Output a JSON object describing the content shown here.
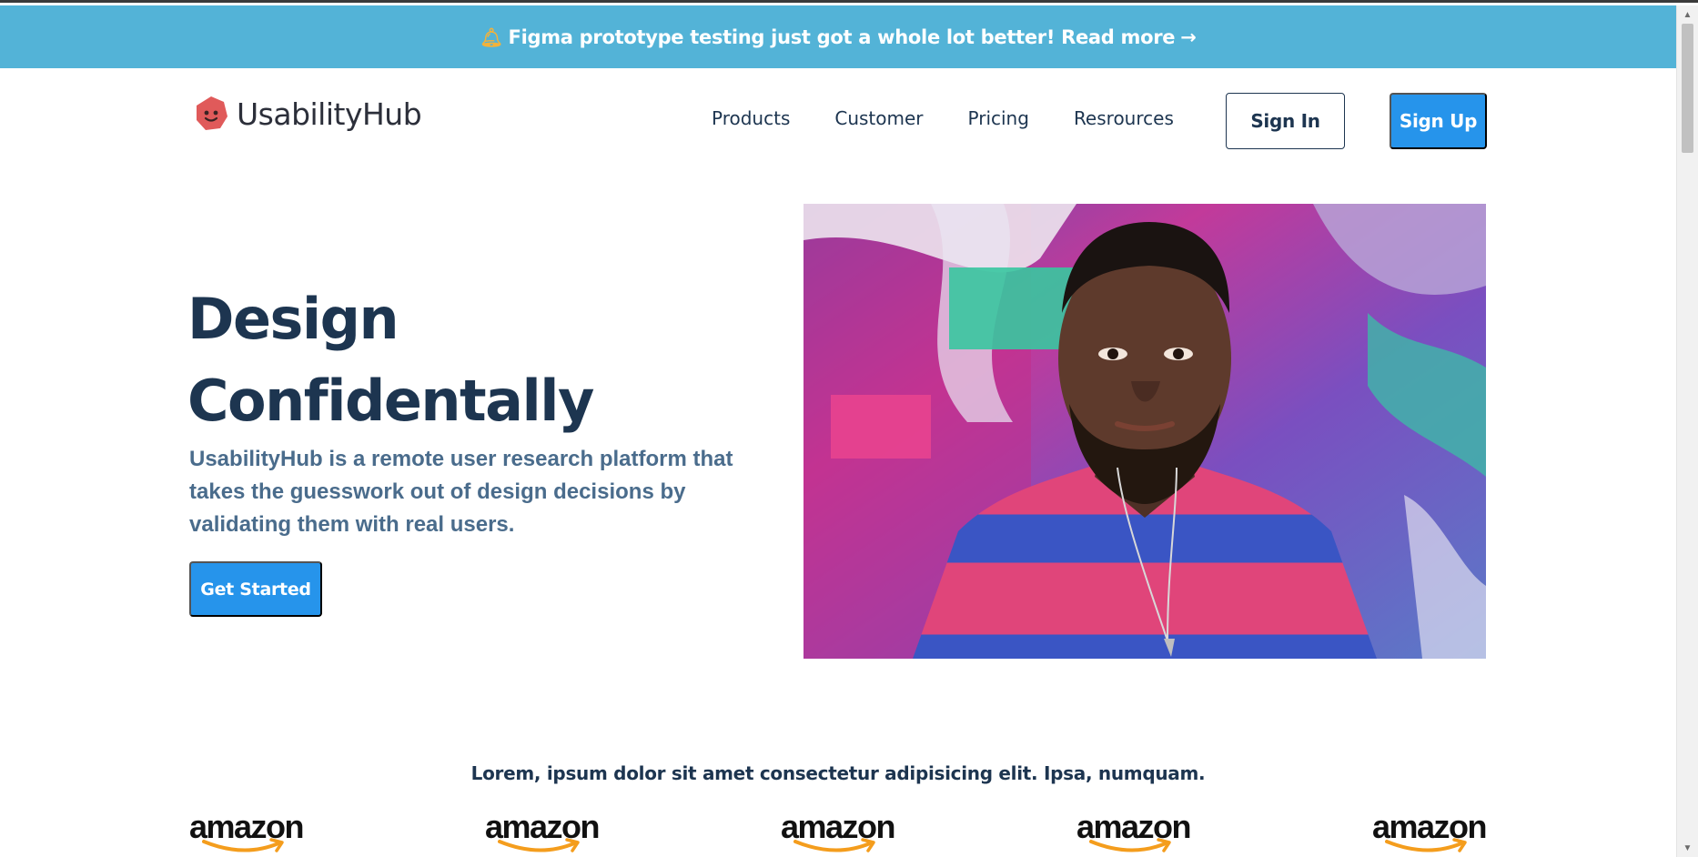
{
  "colors": {
    "banner": "#53b3d7",
    "accent": "#2694eb",
    "navy": "#1d3550",
    "subtitle": "#4a6c8c",
    "logo": "#e05a5a"
  },
  "announcement": {
    "icon": "bell-icon",
    "text": "Figma prototype testing just got a whole lot better! Read more",
    "arrow": "→"
  },
  "brand": {
    "name": "UsabilityHub",
    "icon": "usabilityhub-logo-icon"
  },
  "nav": {
    "items": [
      {
        "label": "Products"
      },
      {
        "label": "Customer"
      },
      {
        "label": "Pricing"
      },
      {
        "label": "Resrources"
      }
    ]
  },
  "auth": {
    "sign_in": "Sign In",
    "sign_up": "Sign Up"
  },
  "hero": {
    "title_line1": "Design",
    "title_line2": "Confidentally",
    "subtitle": "UsabilityHub is a remote user research platform that takes the guesswork out of design decisions by validating them with real users.",
    "cta": "Get Started",
    "image": "portrait-photo"
  },
  "clients": {
    "tagline": "Lorem, ipsum dolor sit amet consectetur adipisicing elit. Ipsa, numquam.",
    "logos": [
      {
        "name": "amazon"
      },
      {
        "name": "amazon"
      },
      {
        "name": "amazon"
      },
      {
        "name": "amazon"
      },
      {
        "name": "amazon"
      }
    ]
  }
}
